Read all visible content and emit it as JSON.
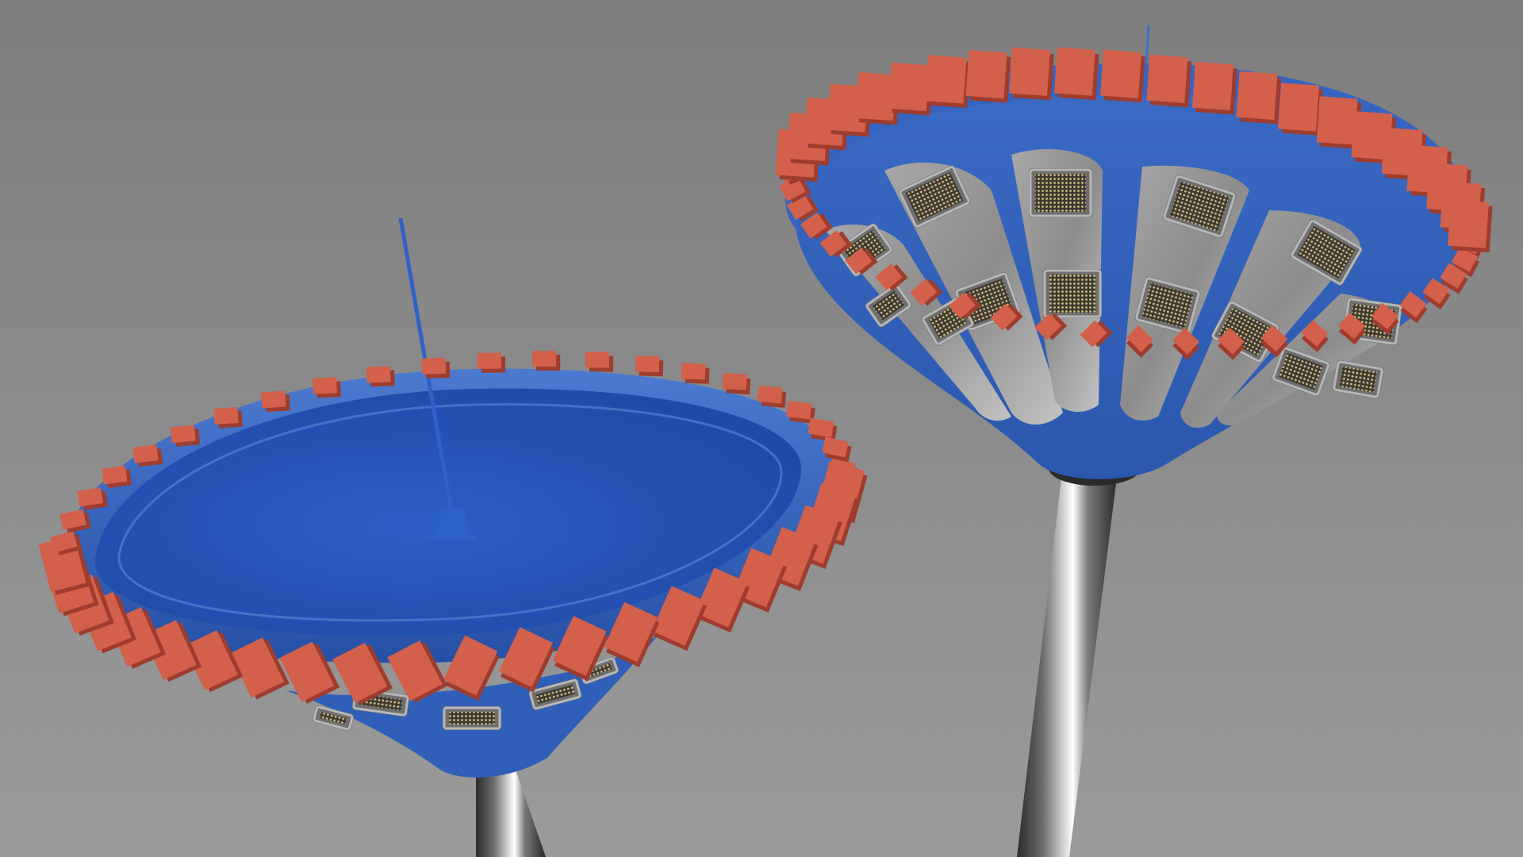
{
  "scene": {
    "background_top": "#7d7d7d",
    "background_bottom": "#9b9b9b"
  },
  "colors": {
    "shade_blue": "#3f6fc6",
    "shade_blue_dark": "#23479a",
    "shade_blue_light": "#5b87d6",
    "blocks_orange": "#d2604a",
    "blocks_orange_dark": "#9e3c2e",
    "pole_chrome_light": "#f2f2f2",
    "pole_chrome_dark": "#3a3a3a",
    "led_housing": "#b7b7b7",
    "led_housing_dark": "#6f6f6f",
    "led_dots": "#c9b277"
  },
  "lamps": [
    {
      "name": "left-lamp-top-view",
      "rim_blocks": 44,
      "visible_led_panels": 5
    },
    {
      "name": "right-lamp-underside-view",
      "rim_blocks": 46,
      "visible_led_panels": 14
    }
  ]
}
